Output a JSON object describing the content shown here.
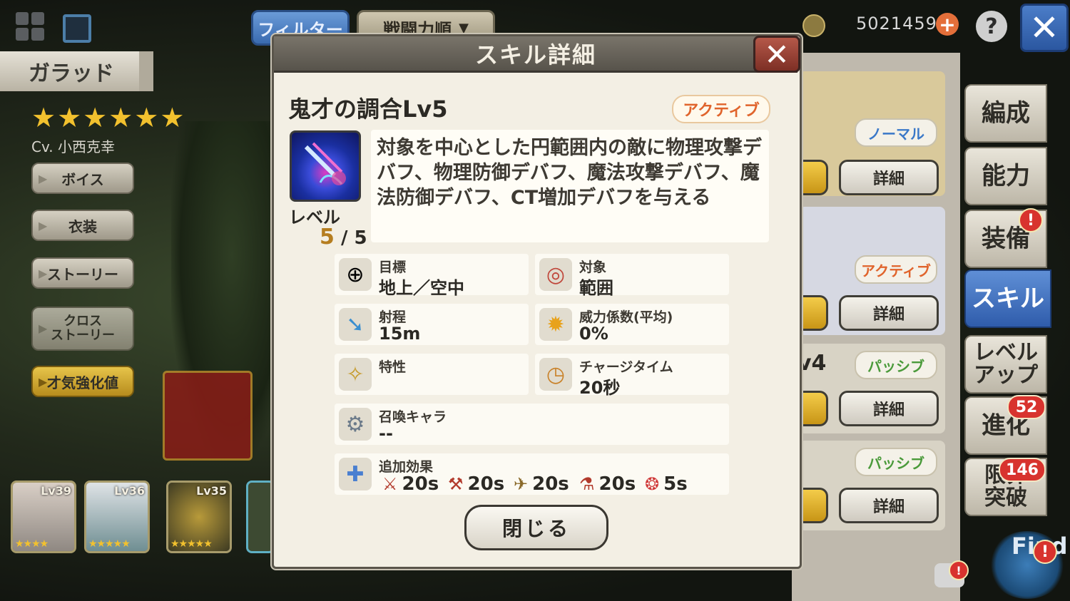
{
  "topbar": {
    "filter_label": "フィルター",
    "sort_label": "戦闘力順",
    "currency_value": "5021459"
  },
  "character": {
    "name": "ガラッド",
    "stars": "★★★★★★",
    "cv": "Cv. 小西克幸"
  },
  "sidebar": {
    "voice": "ボイス",
    "costume": "衣装",
    "story": "ストーリー",
    "cross_story": "クロス\nストーリー",
    "talent": "才気強化値"
  },
  "roster": [
    {
      "level": "Lv39",
      "stars": "★★★★"
    },
    {
      "level": "Lv36",
      "stars": "★★★★★"
    },
    {
      "level": "Lv35",
      "stars": "★★★★★"
    }
  ],
  "right_panel": {
    "cards": [
      {
        "type": "ノーマル",
        "detail": "詳細"
      },
      {
        "type": "アクティブ",
        "detail": "詳細"
      },
      {
        "type": "パッシブ",
        "detail": "詳細",
        "fragment": "v4"
      },
      {
        "type": "パッシブ",
        "detail": "詳細"
      }
    ],
    "tabs": {
      "formation": "編成",
      "ability": "能力",
      "equipment": "装備",
      "skill": "スキル",
      "level_up": "レベル\nアップ",
      "evolve": "進化",
      "limit_break": "限界\n突破"
    },
    "badges": {
      "evolve": "52",
      "limit_break": "146"
    }
  },
  "modal": {
    "title": "スキル詳細",
    "skill_name": "鬼才の調合Lv5",
    "skill_type": "アクティブ",
    "level_label": "レベル",
    "level_current": "5",
    "level_max": "/ 5",
    "description": "対象を中心とした円範囲内の敵に物理攻撃デバフ、物理防御デバフ、魔法攻撃デバフ、魔法防御デバフ、CT増加デバフを与える",
    "stats": {
      "target_label": "目標",
      "target_value": "地上／空中",
      "scope_label": "対象",
      "scope_value": "範囲",
      "range_label": "射程",
      "range_value": "15m",
      "power_label": "威力係数(平均)",
      "power_value": "0%",
      "trait_label": "特性",
      "trait_value": "",
      "charge_label": "チャージタイム",
      "charge_value": "20秒",
      "summon_label": "召喚キャラ",
      "summon_value": "--",
      "extra_label": "追加効果"
    },
    "effects": [
      {
        "icon": "physical-attack-down-icon",
        "duration": "20s"
      },
      {
        "icon": "physical-defense-down-icon",
        "duration": "20s"
      },
      {
        "icon": "magic-attack-down-icon",
        "duration": "20s"
      },
      {
        "icon": "magic-defense-down-icon",
        "duration": "20s"
      },
      {
        "icon": "ct-up-icon",
        "duration": "5s"
      }
    ],
    "close_label": "閉じる"
  },
  "find_label": "Find",
  "colors": {
    "accent_blue": "#3a6bb0",
    "active_orange": "#e0642c",
    "passive_green": "#4a9a3a",
    "normal_blue": "#3a78c8",
    "star_gold": "#f2c12e"
  }
}
